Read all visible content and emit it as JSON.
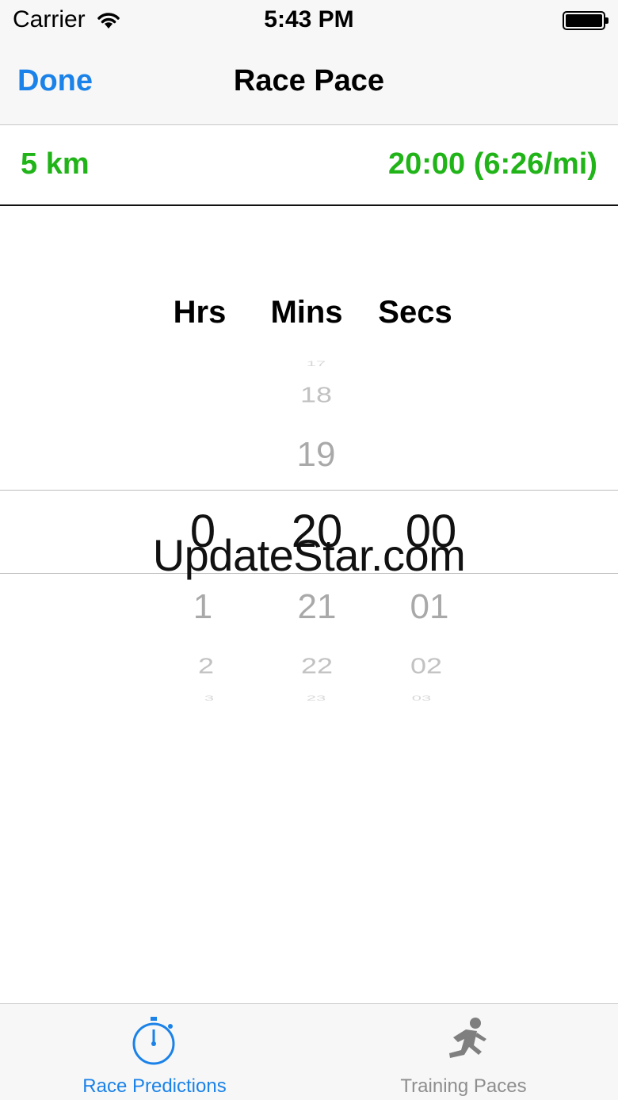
{
  "status_bar": {
    "carrier": "Carrier",
    "time": "5:43 PM"
  },
  "nav": {
    "done_label": "Done",
    "title": "Race Pace"
  },
  "summary": {
    "distance": "5 km",
    "result": "20:00 (6:26/mi)"
  },
  "picker": {
    "headers": {
      "hours": "Hrs",
      "minutes": "Mins",
      "seconds": "Secs"
    },
    "hours": {
      "selected": "0",
      "next": [
        "1",
        "2",
        "3"
      ]
    },
    "minutes": {
      "selected": "20",
      "prev": [
        "19",
        "18",
        "17"
      ],
      "next": [
        "21",
        "22",
        "23"
      ]
    },
    "seconds": {
      "selected": "00",
      "next": [
        "01",
        "02",
        "03"
      ]
    }
  },
  "watermark": "UpdateStar.com",
  "tabbar": {
    "tabs": [
      {
        "label": "Race Predictions",
        "icon": "stopwatch-icon",
        "active": true
      },
      {
        "label": "Training Paces",
        "icon": "runner-icon",
        "active": false
      }
    ]
  },
  "colors": {
    "accent": "#1a82e8",
    "green": "#21b419"
  }
}
